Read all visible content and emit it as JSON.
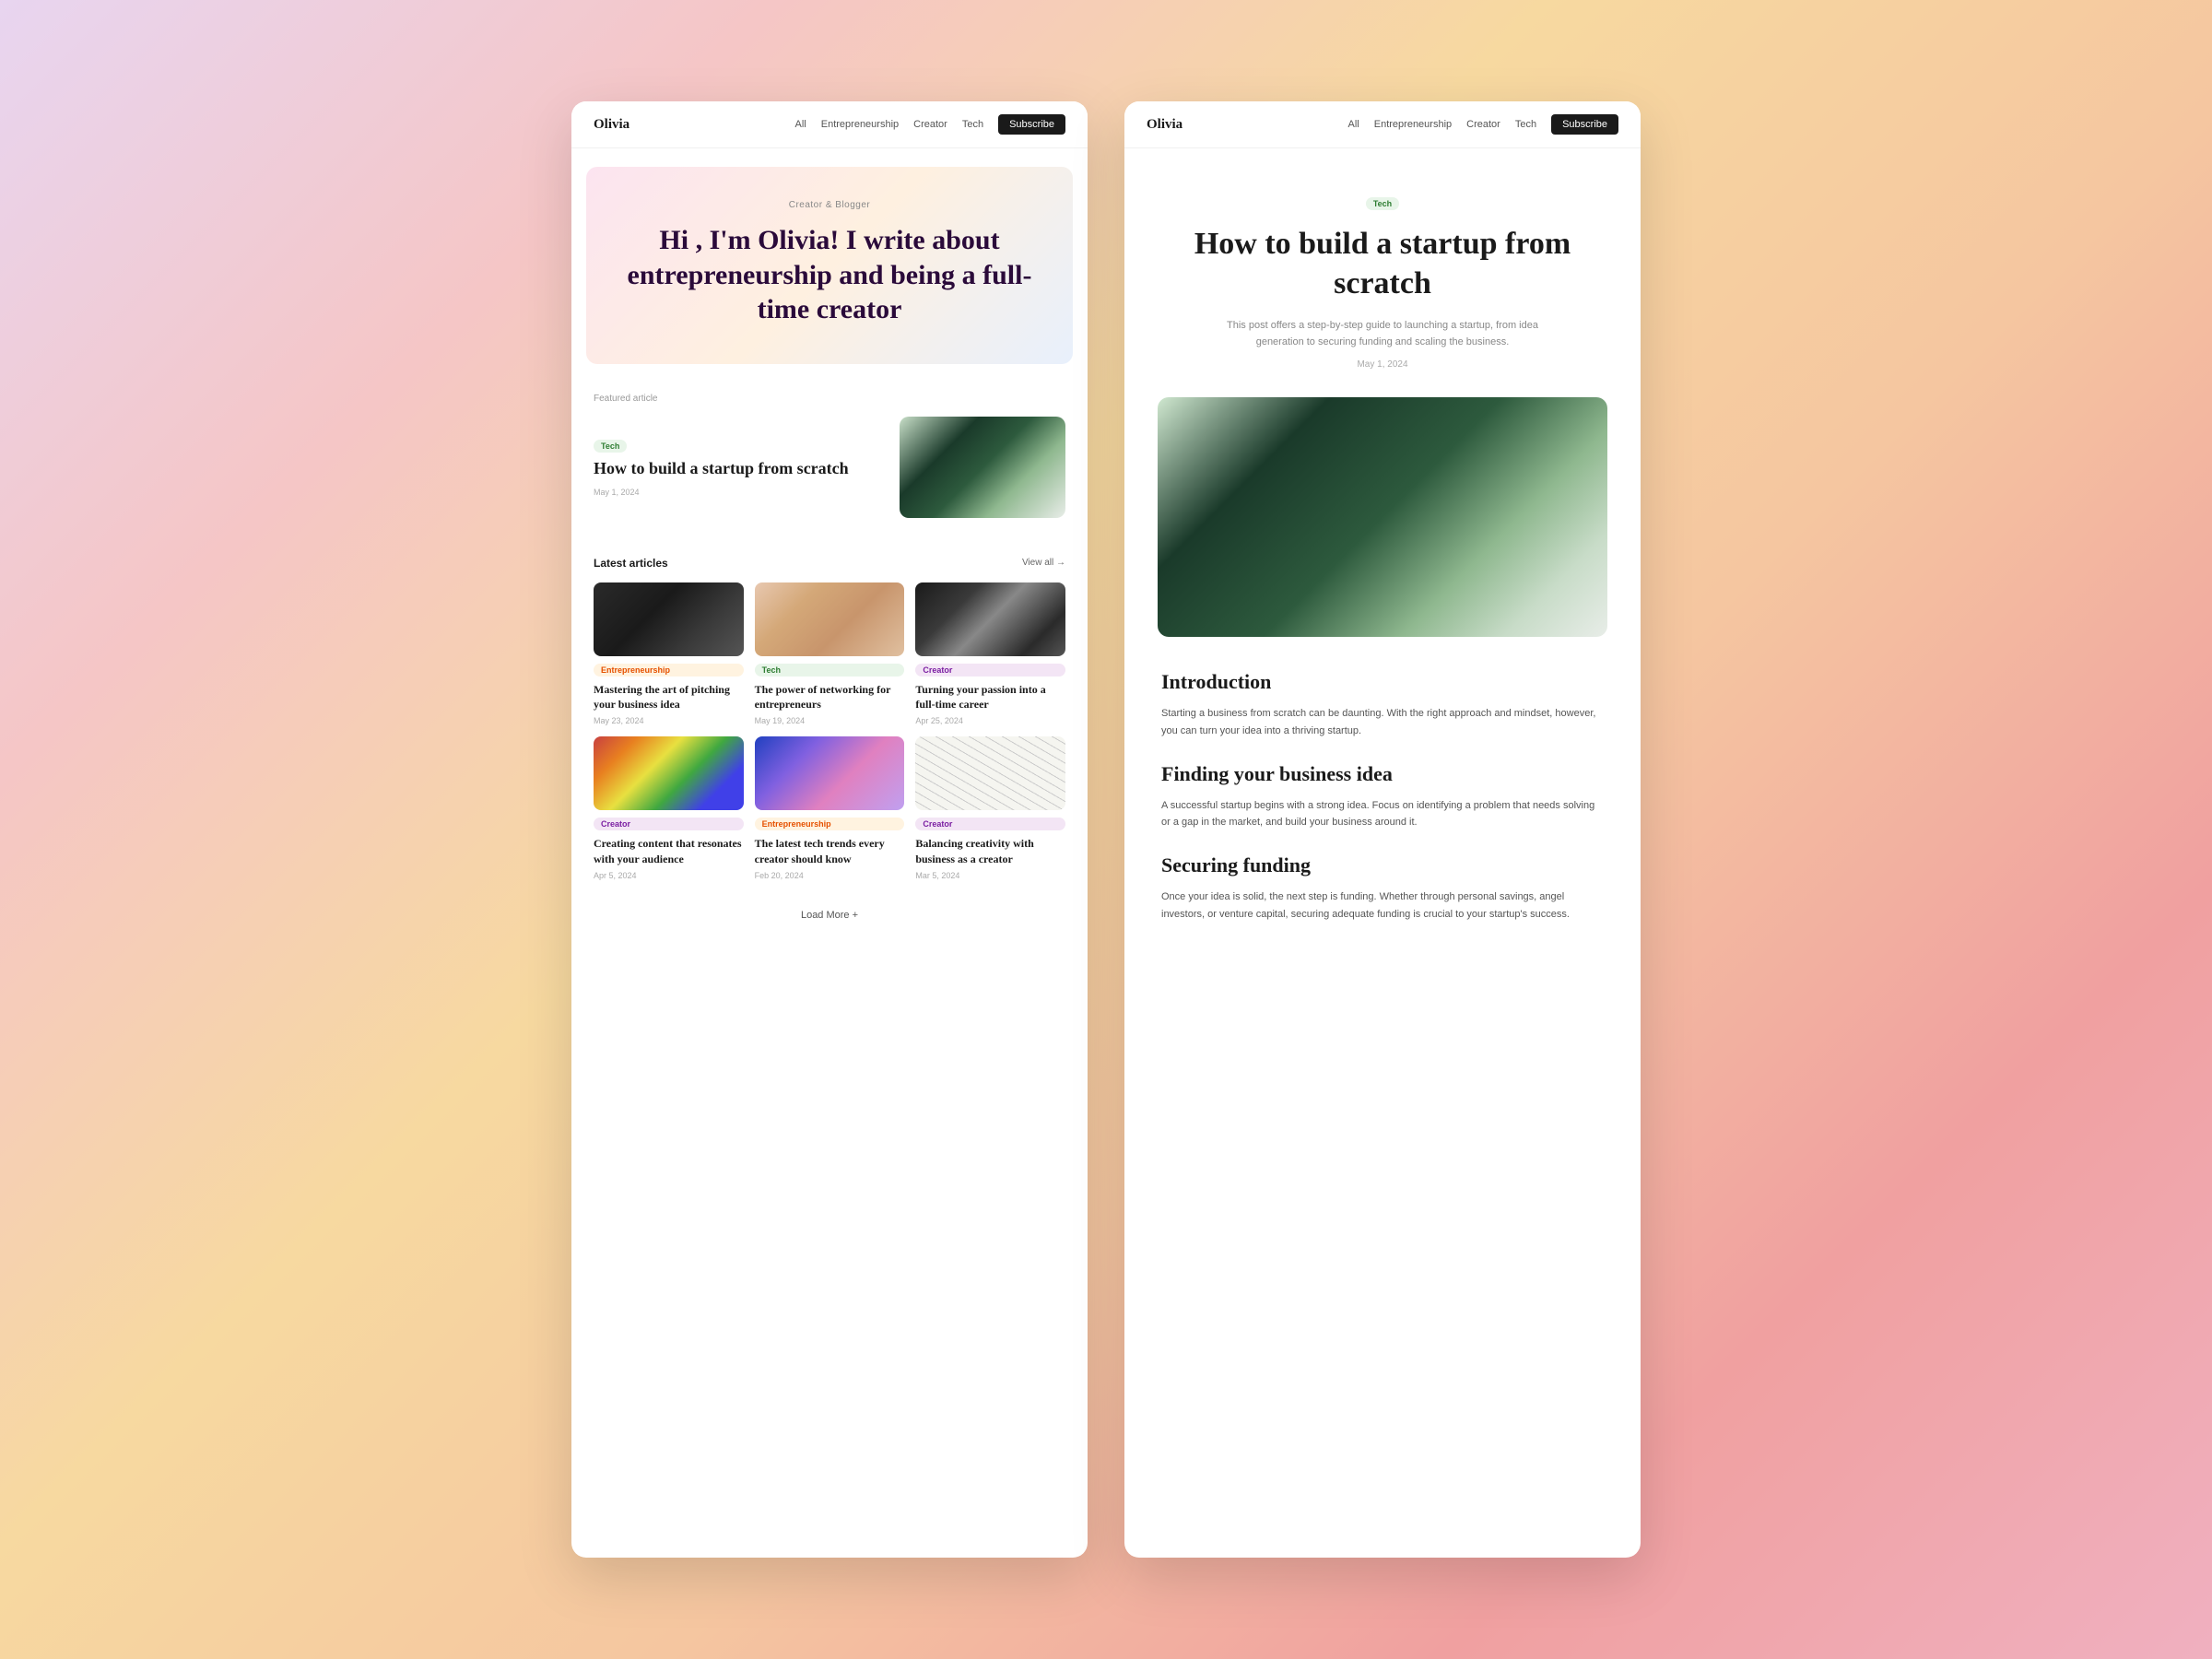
{
  "site": {
    "logo": "Olivia",
    "nav": {
      "links": [
        "All",
        "Entrepreneurship",
        "Creator",
        "Tech"
      ],
      "subscribe_label": "Subscribe"
    }
  },
  "left_page": {
    "hero": {
      "subtitle": "Creator & Blogger",
      "title": "Hi , I'm Olivia! I write about entrepreneurship and being a full-time creator"
    },
    "featured_section": {
      "label": "Featured article",
      "article": {
        "tag": "Tech",
        "tag_type": "tag-tech",
        "title": "How to build a startup from scratch",
        "date": "May 1, 2024"
      }
    },
    "latest_section": {
      "label": "Latest articles",
      "view_all": "View all →",
      "articles": [
        {
          "tag": "Entrepreneurship",
          "tag_type": "tag-entrepreneurship",
          "title": "Mastering the art of pitching your business idea",
          "date": "May 23, 2024",
          "image_type": "dark"
        },
        {
          "tag": "Tech",
          "tag_type": "tag-tech",
          "title": "The power of networking for entrepreneurs",
          "date": "May 19, 2024",
          "image_type": "skin"
        },
        {
          "tag": "Creator",
          "tag_type": "tag-creator",
          "title": "Turning your passion into a full-time career",
          "date": "Apr 25, 2024",
          "image_type": "shadow"
        },
        {
          "tag": "Creator",
          "tag_type": "tag-creator",
          "title": "Creating content that resonates with your audience",
          "date": "Apr 5, 2024",
          "image_type": "colorful"
        },
        {
          "tag": "Entrepreneurship",
          "tag_type": "tag-entrepreneurship",
          "title": "The latest tech trends every creator should know",
          "date": "Feb 20, 2024",
          "image_type": "blue"
        },
        {
          "tag": "Creator",
          "tag_type": "tag-creator",
          "title": "Balancing creativity with business as a creator",
          "date": "Mar 5, 2024",
          "image_type": "lines"
        }
      ]
    },
    "load_more": "Load More +"
  },
  "right_page": {
    "article": {
      "tag": "Tech",
      "tag_type": "tag-tech",
      "title": "How to build a startup from scratch",
      "description": "This post offers a step-by-step guide to launching a startup, from idea generation to securing funding and scaling the business.",
      "date": "May 1, 2024",
      "sections": [
        {
          "heading": "Introduction",
          "body": "Starting a business from scratch can be daunting. With the right approach and mindset, however, you can turn your idea into a thriving startup."
        },
        {
          "heading": "Finding your business idea",
          "body": "A successful startup begins with a strong idea. Focus on identifying a problem that needs solving or a gap in the market, and build your business around it."
        },
        {
          "heading": "Securing funding",
          "body": "Once your idea is solid, the next step is funding. Whether through personal savings, angel investors, or venture capital, securing adequate funding is crucial to your startup's success."
        }
      ]
    }
  }
}
